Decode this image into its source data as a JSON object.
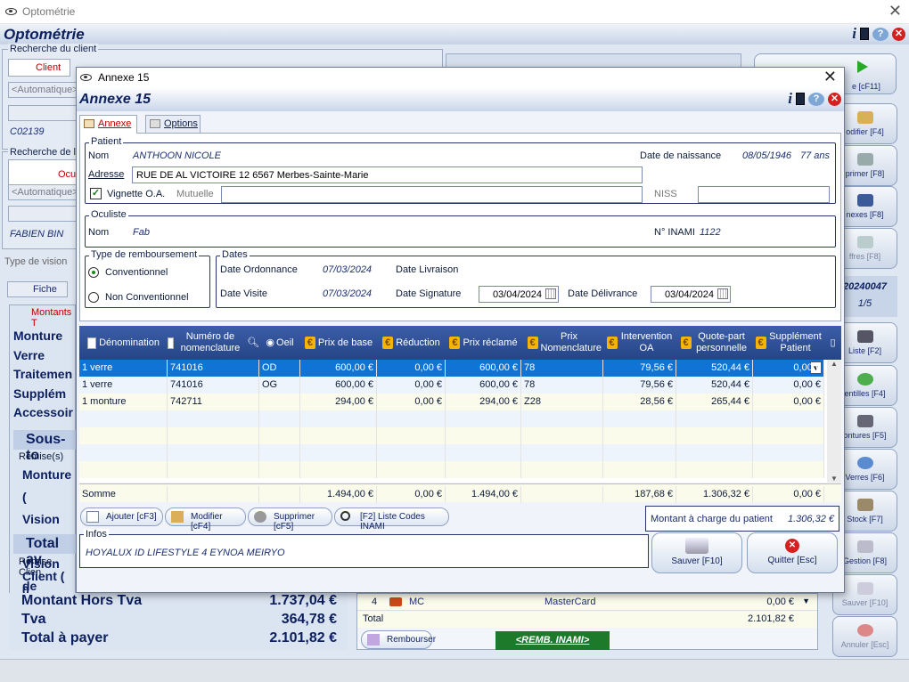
{
  "outer": {
    "window_title": "Optométrie",
    "app_heading": "Optométrie",
    "search_client_legend": "Recherche du client",
    "tab_client": "Client",
    "auto_placeholder": "<Automatique>",
    "client_code": "C02139",
    "search_oculist_legend": "Recherche de l",
    "tab_oculist": "Ocul",
    "oculist_name": "FABIEN BIN",
    "vision_type_label": "Type de vision",
    "fiche_tab": "Fiche",
    "montants_tab": "Montants T",
    "sections": [
      "Monture",
      "Verre",
      "Traitemen",
      "Supplém",
      "Accessoir"
    ],
    "sous_total": "Sous-to",
    "remises_legend": "Remise(s)",
    "remise_rows": [
      "Monture (",
      "Vision de",
      "Vision de"
    ],
    "total_av": "Total av",
    "remise_client_legend": "Remise Clien",
    "client_remise": "Client ( 0",
    "totals": [
      {
        "label": "Montant Hors Tva",
        "value": "1.737,04 €"
      },
      {
        "label": "Tva",
        "value": "364,78 €"
      },
      {
        "label": "Total à payer",
        "value": "2.101,82 €"
      }
    ],
    "payment_row": {
      "num": "4",
      "code": "MC",
      "name": "MasterCard",
      "amount": "0,00 €"
    },
    "payment_total_label": "Total",
    "payment_total": "2.101,82 €",
    "rembourser_label": "Rembourser",
    "remb_inami": "<REMB. INAMI>",
    "right_buttons": [
      "e [cF11]",
      "odifier [F4]",
      "primer [F8]",
      "nexes [F8]",
      "ffres [F8]"
    ],
    "doc_number": "20240047",
    "doc_page": "1/5",
    "right_buttons2": [
      "Liste [F2]",
      "entilles [F4]",
      "ontures [F5]",
      "Verres [F6]",
      "Stock [F7]",
      "Gestion [F8]",
      "Sauver [F10]",
      "Annuler [Esc]"
    ]
  },
  "modal": {
    "window_title": "Annexe 15",
    "heading": "Annexe 15",
    "tabs": [
      {
        "label": "Annexe"
      },
      {
        "label": "Options"
      }
    ],
    "patient": {
      "legend": "Patient",
      "nom_label": "Nom",
      "nom": "ANTHOON NICOLE",
      "dob_label": "Date de naissance",
      "dob": "08/05/1946",
      "age": "77 ans",
      "adresse_label": "Adresse",
      "adresse": "RUE DE AL VICTOIRE 12 6567 Merbes-Sainte-Marie",
      "vignette_label": "Vignette O.A.",
      "vignette_checked": true,
      "mutuelle_label": "Mutuelle",
      "mutuelle": "",
      "niss_label": "NISS",
      "niss": ""
    },
    "oculiste": {
      "legend": "Oculiste",
      "nom_label": "Nom",
      "nom": "Fab",
      "inami_label": "N° INAMI",
      "inami": "1122"
    },
    "remboursement": {
      "legend": "Type de remboursement",
      "options": [
        "Conventionnel",
        "Non Conventionnel"
      ],
      "selected": "Conventionnel"
    },
    "dates": {
      "legend": "Dates",
      "ordonnance_label": "Date Ordonnance",
      "ordonnance": "07/03/2024",
      "livraison_label": "Date Livraison",
      "visite_label": "Date Visite",
      "visite": "07/03/2024",
      "signature_label": "Date Signature",
      "signature": "03/04/2024",
      "delivrance_label": "Date Délivrance",
      "delivrance": "03/04/2024"
    },
    "grid": {
      "columns": [
        "Dénomination",
        "Numéro de nomenclature",
        "Oeil",
        "Prix de base",
        "Réduction",
        "Prix réclamé",
        "Prix Nomenclature",
        "Intervention OA",
        "Quote-part personnelle",
        "Supplément Patient"
      ],
      "rows": [
        [
          "1 verre",
          "741016",
          "OD",
          "600,00 €",
          "0,00 €",
          "600,00 €",
          "78",
          "79,56 €",
          "520,44 €",
          "0,00 €"
        ],
        [
          "1 verre",
          "741016",
          "OG",
          "600,00 €",
          "0,00 €",
          "600,00 €",
          "78",
          "79,56 €",
          "520,44 €",
          "0,00 €"
        ],
        [
          "1 monture",
          "742711",
          "",
          "294,00 €",
          "0,00 €",
          "294,00 €",
          "Z28",
          "28,56 €",
          "265,44 €",
          "0,00 €"
        ]
      ],
      "totals": [
        "Somme",
        "",
        "",
        "1.494,00 €",
        "0,00 €",
        "1.494,00 €",
        "",
        "187,68 €",
        "1.306,32 €",
        "0,00 €"
      ]
    },
    "buttons": {
      "ajouter": "Ajouter [cF3]",
      "modifier": "Modifier [cF4]",
      "supprimer": "Supprimer [cF5]",
      "liste": "[F2] Liste Codes INAMI"
    },
    "montant_label": "Montant à charge du patient",
    "montant": "1.306,32 €",
    "infos_legend": "Infos",
    "infos": "HOYALUX ID LIFESTYLE 4 EYNOA MEIRYO",
    "sauver": "Sauver [F10]",
    "quitter": "Quitter [Esc]"
  },
  "colors": {
    "accent": "#0f74d6",
    "header": "#254587",
    "cream": "#fbfbec"
  }
}
